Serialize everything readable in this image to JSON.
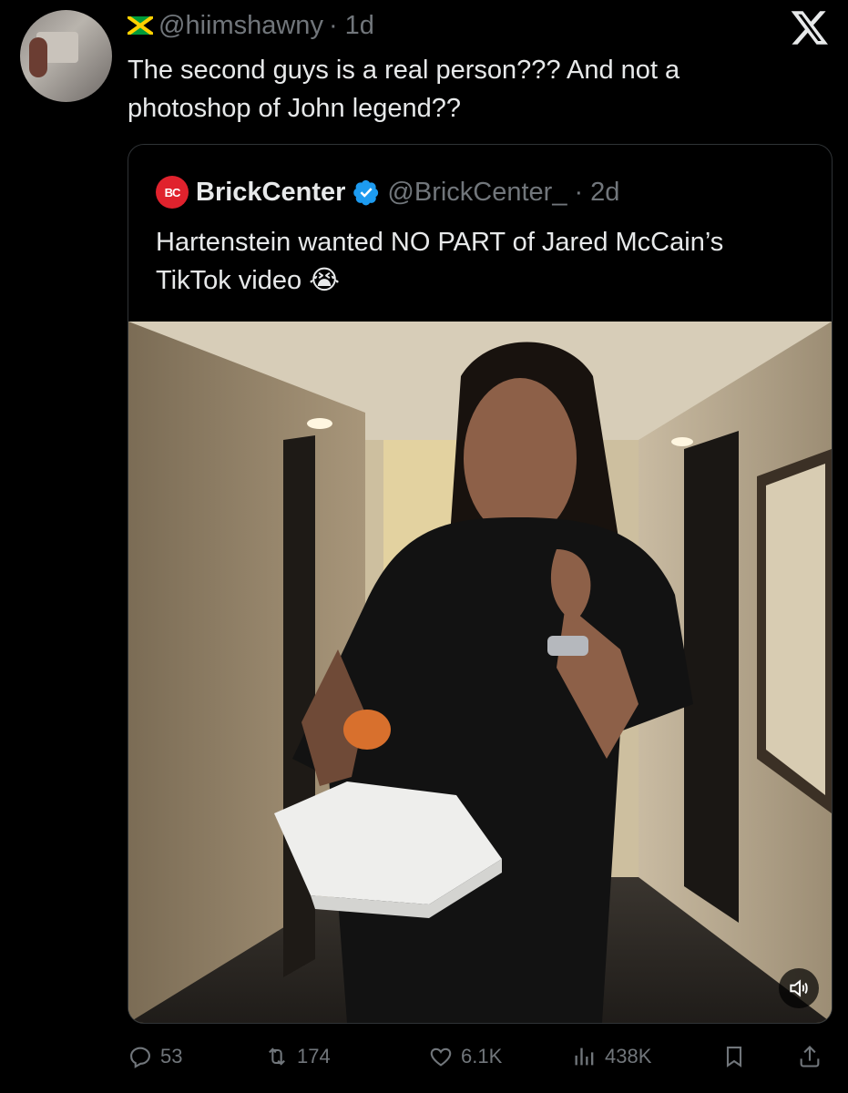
{
  "tweet": {
    "handle": "@hiimshawny",
    "time": "· 1d",
    "text": "The second guys is a real person??? And not a photoshop of John legend??"
  },
  "quote": {
    "logo_text": "BC",
    "name": "BrickCenter",
    "handle": "@BrickCenter_",
    "time": "· 2d",
    "text": "Hartenstein wanted NO PART of Jared McCain’s TikTok video",
    "emoji": "😭"
  },
  "actions": {
    "replies": "53",
    "reposts": "174",
    "likes": "6.1K",
    "views": "438K"
  },
  "icons": [
    "flag-icon",
    "x-logo-icon",
    "verified-badge-icon",
    "speaker-icon",
    "reply-icon",
    "repost-icon",
    "like-icon",
    "views-icon",
    "bookmark-icon",
    "share-icon"
  ],
  "colors": {
    "background": "#000000",
    "text": "#e7e9ea",
    "muted": "#71767b",
    "verified": "#1d9bf0",
    "brand_red": "#e0222d"
  }
}
